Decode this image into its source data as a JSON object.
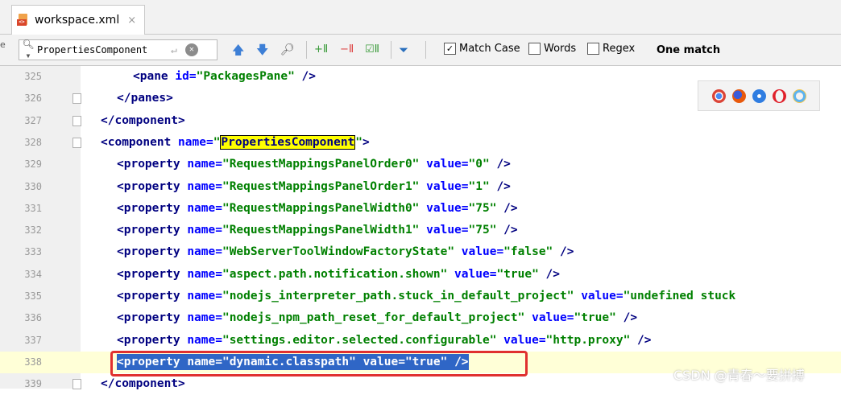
{
  "tab": {
    "filename": "workspace.xml",
    "close": "×"
  },
  "search": {
    "left_char": "e",
    "query": "PropertiesComponent",
    "options": [
      {
        "label": "Match Case",
        "checked": true
      },
      {
        "label": "Words",
        "checked": false
      },
      {
        "label": "Regex",
        "checked": false
      }
    ],
    "result": "One match"
  },
  "browsers": [
    "chrome",
    "firefox",
    "safari",
    "opera",
    "ie"
  ],
  "lines": [
    {
      "n": "325",
      "indent": 3,
      "segs": [
        [
          "t",
          "<pane "
        ],
        [
          "a",
          "id="
        ],
        [
          "v",
          "\"PackagesPane\""
        ],
        [
          "t",
          " />"
        ]
      ]
    },
    {
      "n": "326",
      "indent": 2,
      "segs": [
        [
          "t",
          "</panes>"
        ]
      ]
    },
    {
      "n": "327",
      "indent": 1,
      "segs": [
        [
          "t",
          "</component>"
        ]
      ]
    },
    {
      "n": "328",
      "indent": 1,
      "segs": [
        [
          "t",
          "<component "
        ],
        [
          "a",
          "name="
        ],
        [
          "v",
          "\""
        ],
        [
          "find",
          "PropertiesComponent"
        ],
        [
          "v",
          "\""
        ],
        [
          "t",
          ">"
        ]
      ]
    },
    {
      "n": "329",
      "indent": 2,
      "segs": [
        [
          "t",
          "<property "
        ],
        [
          "a",
          "name="
        ],
        [
          "v",
          "\"RequestMappingsPanelOrder0\""
        ],
        [
          "a",
          " value="
        ],
        [
          "v",
          "\"0\""
        ],
        [
          "t",
          " />"
        ]
      ]
    },
    {
      "n": "330",
      "indent": 2,
      "segs": [
        [
          "t",
          "<property "
        ],
        [
          "a",
          "name="
        ],
        [
          "v",
          "\"RequestMappingsPanelOrder1\""
        ],
        [
          "a",
          " value="
        ],
        [
          "v",
          "\"1\""
        ],
        [
          "t",
          " />"
        ]
      ]
    },
    {
      "n": "331",
      "indent": 2,
      "segs": [
        [
          "t",
          "<property "
        ],
        [
          "a",
          "name="
        ],
        [
          "v",
          "\"RequestMappingsPanelWidth0\""
        ],
        [
          "a",
          " value="
        ],
        [
          "v",
          "\"75\""
        ],
        [
          "t",
          " />"
        ]
      ]
    },
    {
      "n": "332",
      "indent": 2,
      "segs": [
        [
          "t",
          "<property "
        ],
        [
          "a",
          "name="
        ],
        [
          "v",
          "\"RequestMappingsPanelWidth1\""
        ],
        [
          "a",
          " value="
        ],
        [
          "v",
          "\"75\""
        ],
        [
          "t",
          " />"
        ]
      ]
    },
    {
      "n": "333",
      "indent": 2,
      "segs": [
        [
          "t",
          "<property "
        ],
        [
          "a",
          "name="
        ],
        [
          "v",
          "\"WebServerToolWindowFactoryState\""
        ],
        [
          "a",
          " value="
        ],
        [
          "v",
          "\"false\""
        ],
        [
          "t",
          " />"
        ]
      ]
    },
    {
      "n": "334",
      "indent": 2,
      "segs": [
        [
          "t",
          "<property "
        ],
        [
          "a",
          "name="
        ],
        [
          "v",
          "\"aspect.path.notification.shown\""
        ],
        [
          "a",
          " value="
        ],
        [
          "v",
          "\"true\""
        ],
        [
          "t",
          " />"
        ]
      ]
    },
    {
      "n": "335",
      "indent": 2,
      "segs": [
        [
          "t",
          "<property "
        ],
        [
          "a",
          "name="
        ],
        [
          "v",
          "\"nodejs_interpreter_path.stuck_in_default_project\""
        ],
        [
          "a",
          " value="
        ],
        [
          "v",
          "\"undefined stuck"
        ]
      ]
    },
    {
      "n": "336",
      "indent": 2,
      "segs": [
        [
          "t",
          "<property "
        ],
        [
          "a",
          "name="
        ],
        [
          "v",
          "\"nodejs_npm_path_reset_for_default_project\""
        ],
        [
          "a",
          " value="
        ],
        [
          "v",
          "\"true\""
        ],
        [
          "t",
          " />"
        ]
      ]
    },
    {
      "n": "337",
      "indent": 2,
      "segs": [
        [
          "t",
          "<property "
        ],
        [
          "a",
          "name="
        ],
        [
          "v",
          "\"settings.editor.selected.configurable\""
        ],
        [
          "a",
          " value="
        ],
        [
          "v",
          "\"http.proxy\""
        ],
        [
          "t",
          " />"
        ]
      ]
    },
    {
      "n": "338",
      "indent": 2,
      "selected": true,
      "segs": [
        [
          "t",
          "<property "
        ],
        [
          "a",
          "name="
        ],
        [
          "v",
          "\"dynamic.classpath\""
        ],
        [
          "a",
          " value="
        ],
        [
          "v",
          "\"true\""
        ],
        [
          "t",
          " />"
        ]
      ]
    },
    {
      "n": "339",
      "indent": 1,
      "segs": [
        [
          "t",
          "</component>"
        ]
      ]
    }
  ],
  "watermark": "CSDN @青春～要拼搏",
  "colors": {
    "tag": "#000080",
    "attr": "#0000ff",
    "value": "#008000",
    "selection": "#2f66c6",
    "find_highlight": "#ffff00",
    "annotation": "#e0302f"
  }
}
